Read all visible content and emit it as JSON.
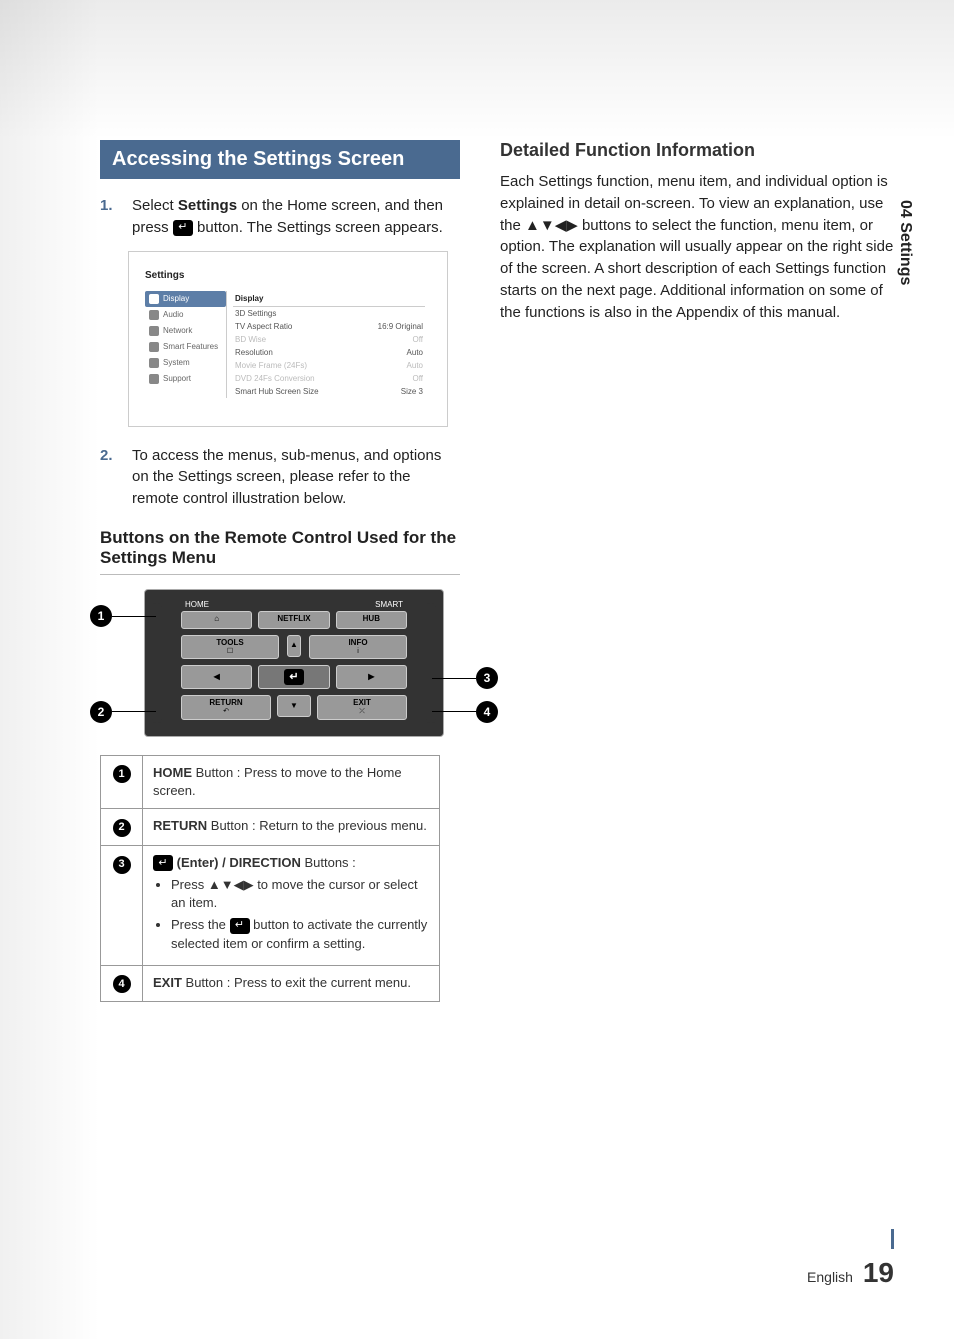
{
  "sidebar_tab": "04  Settings",
  "main": {
    "section_title": "Accessing the Settings Screen",
    "step1_num": "1.",
    "step1_pre": "Select ",
    "step1_bold": "Settings",
    "step1_mid": " on the Home screen, and then press ",
    "step1_post": " button. The Settings screen appears.",
    "step2_num": "2.",
    "step2_text": "To access the menus, sub-menus, and options on the Settings screen, please refer to the remote control illustration below.",
    "sub_heading": "Buttons on the Remote Control Used for the Settings Menu"
  },
  "settings_mock": {
    "title": "Settings",
    "nav": [
      "Display",
      "Audio",
      "Network",
      "Smart Features",
      "System",
      "Support"
    ],
    "pane_title": "Display",
    "rows": [
      {
        "label": "3D Settings",
        "value": "",
        "dim": false
      },
      {
        "label": "TV Aspect Ratio",
        "value": "16:9 Original",
        "dim": false
      },
      {
        "label": "BD Wise",
        "value": "Off",
        "dim": true
      },
      {
        "label": "Resolution",
        "value": "Auto",
        "dim": false
      },
      {
        "label": "Movie Frame (24Fs)",
        "value": "Auto",
        "dim": true
      },
      {
        "label": "DVD 24Fs Conversion",
        "value": "Off",
        "dim": true
      },
      {
        "label": "Smart Hub Screen Size",
        "value": "Size 3",
        "dim": false
      }
    ]
  },
  "remote": {
    "top_left_label": "HOME",
    "top_right_label": "SMART",
    "home_btn": "⌂",
    "netflix_btn": "NETFLIX",
    "hub_btn": "HUB",
    "tools_btn": "TOOLS",
    "tools_sub": "☐",
    "info_btn": "INFO",
    "info_sub": "i",
    "up": "▲",
    "down": "▼",
    "left": "◀",
    "right": "▶",
    "return_btn": "RETURN",
    "return_sub": "↶",
    "exit_btn": "EXIT",
    "exit_sub": "⤫"
  },
  "callouts": {
    "c1": "1",
    "c2": "2",
    "c3": "3",
    "c4": "4"
  },
  "legend": {
    "r1_num": "1",
    "r1_b": "HOME",
    "r1_t": " Button : Press to move to the Home screen.",
    "r2_num": "2",
    "r2_b": "RETURN",
    "r2_t": " Button : Return to the previous menu.",
    "r3_num": "3",
    "r3_title_b": "(Enter) / DIRECTION",
    "r3_title_t": " Buttons :",
    "r3_li1_pre": "Press ",
    "r3_li1_arrows": "▲▼◀▶",
    "r3_li1_post": " to move the cursor or select an item.",
    "r3_li2_pre": "Press the ",
    "r3_li2_post": " button to activate the currently selected item or confirm a setting.",
    "r4_num": "4",
    "r4_b": "EXIT",
    "r4_t": " Button : Press to exit the current menu."
  },
  "rhs": {
    "heading": "Detailed Function Information",
    "body_pre": "Each Settings function, menu item, and individual option is explained in detail on-screen. To view an explanation, use the ",
    "body_arrows": "▲▼◀▶",
    "body_post": " buttons to select the function, menu item, or option. The explanation will usually appear on the right side of the screen. A short description of each Settings function starts on the next page. Additional information on some of the functions is also in the Appendix of this manual."
  },
  "footer": {
    "lang": "English",
    "page": "19"
  }
}
